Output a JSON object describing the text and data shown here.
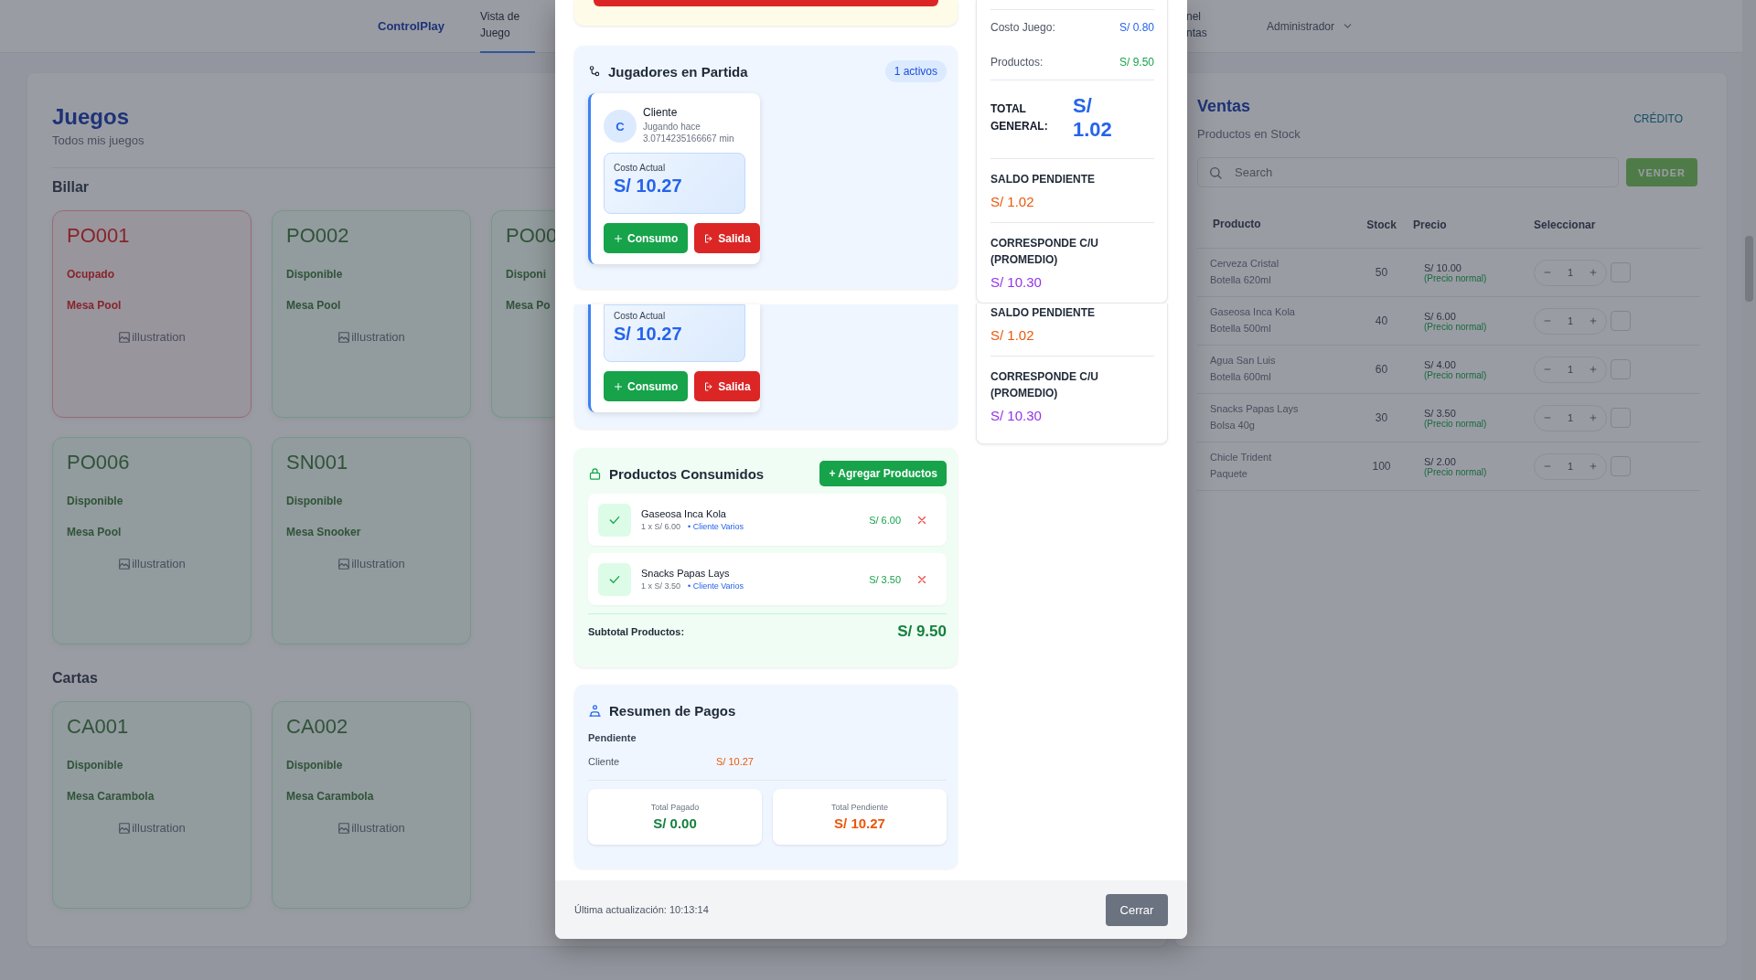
{
  "nav": {
    "brand": "ControlPlay",
    "links": [
      {
        "label": "Vista de Juego",
        "selected": true
      },
      {
        "label": "nel ntas",
        "selected": false
      }
    ],
    "user": "Administrador"
  },
  "games": {
    "title": "Juegos",
    "subtitle": "Todos mis juegos",
    "sections": [
      {
        "name": "Billar",
        "tables": [
          {
            "code": "PO001",
            "status": "Ocupado",
            "occupied": true,
            "type": "Mesa Pool",
            "image_alt": "illustration"
          },
          {
            "code": "PO002",
            "status": "Disponible",
            "occupied": false,
            "type": "Mesa Pool",
            "image_alt": "illustration"
          },
          {
            "code": "PO00",
            "status": "Disponi",
            "occupied": false,
            "type": "Mesa Po"
          },
          {
            "code": "PO006",
            "status": "Disponible",
            "occupied": false,
            "type": "Mesa Pool",
            "image_alt": "illustration"
          },
          {
            "code": "SN001",
            "status": "Disponible",
            "occupied": false,
            "type": "Mesa Snooker",
            "image_alt": "illustration"
          }
        ]
      },
      {
        "name": "Cartas",
        "tables": [
          {
            "code": "CA001",
            "status": "Disponible",
            "occupied": false,
            "type": "Mesa Carambola",
            "image_alt": "illustration"
          },
          {
            "code": "CA002",
            "status": "Disponible",
            "occupied": false,
            "type": "Mesa Carambola",
            "image_alt": "illustration"
          }
        ]
      }
    ]
  },
  "sales": {
    "title": "Ventas",
    "subtitle": "Productos en Stock",
    "credit_link": "CRÉDITO",
    "search": {
      "placeholder": "Search"
    },
    "sell_button": "VENDER",
    "columns": [
      "Producto",
      "Stock",
      "Precio",
      "Seleccionar"
    ],
    "rows": [
      {
        "name": "Cerveza Cristal",
        "detail": "Botella 620ml",
        "stock": "50",
        "price": "S/ 10.00",
        "price_note": "(Precio normal)",
        "quantity": "1",
        "checked": false
      },
      {
        "name": "Gaseosa Inca Kola",
        "detail": "Botella 500ml",
        "stock": "40",
        "price": "S/ 6.00",
        "price_note": "(Precio normal)",
        "quantity": "1",
        "checked": false
      },
      {
        "name": "Agua San Luis",
        "detail": "Botella 600ml",
        "stock": "60",
        "price": "S/ 4.00",
        "price_note": "(Precio normal)",
        "quantity": "1",
        "checked": false
      },
      {
        "name": "Snacks Papas Lays",
        "detail": "Bolsa 40g",
        "stock": "30",
        "price": "S/ 3.50",
        "price_note": "(Precio normal)",
        "quantity": "1",
        "checked": false
      },
      {
        "name": "Chicle Trident",
        "detail": "Paquete",
        "stock": "100",
        "price": "S/ 2.00",
        "price_note": "(Precio normal)",
        "quantity": "1",
        "checked": false
      }
    ]
  },
  "modal": {
    "players": {
      "title": "Jugadores en Partida",
      "badge": "1 activos",
      "cards": [
        {
          "initial": "C",
          "name": "Cliente",
          "elapsed": "Jugando hace 3.0714235166667 min",
          "cost_label": "Costo Actual",
          "cost": "S/ 10.27",
          "consume_button": "Consumo",
          "exit_button": "Salida"
        }
      ]
    },
    "players_overflow": {
      "cost_label": "Costo Actual",
      "cost": "S/ 10.27",
      "consume_button": "Consumo",
      "exit_button": "Salida"
    },
    "products": {
      "title": "Productos Consumidos",
      "add_button": "+ Agregar Productos",
      "items": [
        {
          "name": "Gaseosa Inca Kola",
          "qty_price": "1 x S/ 6.00",
          "client": "• Cliente Varios",
          "total": "S/ 6.00"
        },
        {
          "name": "Snacks Papas Lays",
          "qty_price": "1 x S/ 3.50",
          "client": "• Cliente Varios",
          "total": "S/ 3.50"
        }
      ],
      "subtotal_label": "Subtotal Productos:",
      "subtotal": "S/ 9.50"
    },
    "payments": {
      "title": "Resumen de Pagos",
      "group": "Pendiente",
      "rows": [
        {
          "name": "Cliente",
          "amount": "S/ 10.27"
        }
      ],
      "paid_label": "Total Pagado",
      "paid": "S/ 0.00",
      "pending_label": "Total Pendiente",
      "pending": "S/ 10.27"
    },
    "summary": {
      "lines": [
        {
          "label": "Costo Juego:",
          "value": "S/ 0.80",
          "kind": "game"
        },
        {
          "label": "Productos:",
          "value": "S/ 9.50",
          "kind": "products"
        }
      ],
      "total_label": "TOTAL GENERAL:",
      "total": "S/ 1.02",
      "blocks": [
        {
          "label": "SALDO PENDIENTE",
          "value": "S/ 1.02",
          "kind": "balance"
        },
        {
          "label": "CORRESPONDE C/U (PROMEDIO)",
          "value": "S/ 10.30",
          "kind": "average"
        }
      ]
    },
    "summary_overflow": {
      "blocks": [
        {
          "label": "SALDO PENDIENTE",
          "value": "S/ 1.02",
          "kind": "balance"
        },
        {
          "label": "CORRESPONDE C/U (PROMEDIO)",
          "value": "S/ 10.30",
          "kind": "average"
        }
      ]
    },
    "footer": {
      "updated": "Última actualización: 10:13:14",
      "close_button": "Cerrar"
    }
  }
}
